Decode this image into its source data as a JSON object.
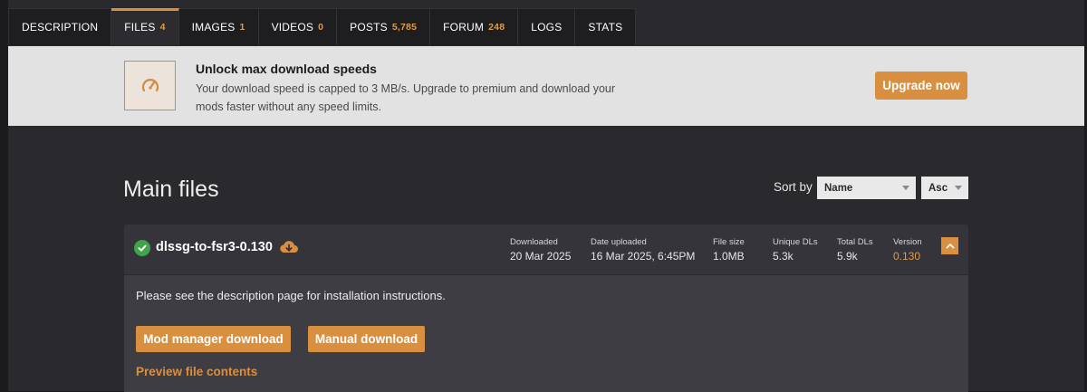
{
  "tabs": [
    {
      "label": "DESCRIPTION",
      "count": ""
    },
    {
      "label": "FILES",
      "count": "4"
    },
    {
      "label": "IMAGES",
      "count": "1"
    },
    {
      "label": "VIDEOS",
      "count": "0"
    },
    {
      "label": "POSTS",
      "count": "5,785"
    },
    {
      "label": "FORUM",
      "count": "248"
    },
    {
      "label": "LOGS",
      "count": ""
    },
    {
      "label": "STATS",
      "count": ""
    }
  ],
  "active_tab": "FILES",
  "banner": {
    "icon": "speedometer-icon",
    "title": "Unlock max download speeds",
    "text": "Your download speed is capped to 3 MB/s. Upgrade to premium and download your mods faster without any speed limits.",
    "button": "Upgrade now"
  },
  "main": {
    "title": "Main files",
    "sort_label": "Sort by",
    "sort_field": "Name",
    "sort_order": "Asc"
  },
  "file": {
    "name": "dlssg-to-fsr3-0.130",
    "status_icon": "check-circle-icon",
    "download_icon": "cloud-download-icon",
    "stats": {
      "downloaded_label": "Downloaded",
      "downloaded": "20 Mar 2025",
      "uploaded_label": "Date uploaded",
      "uploaded": "16 Mar 2025, 6:45PM",
      "size_label": "File size",
      "size": "1.0MB",
      "unique_label": "Unique DLs",
      "unique": "5.3k",
      "total_label": "Total DLs",
      "total": "5.9k",
      "version_label": "Version",
      "version": "0.130"
    },
    "description": "Please see the description page for installation instructions.",
    "mod_manager_button": "Mod manager download",
    "manual_button": "Manual download",
    "preview_link": "Preview file contents"
  },
  "colors": {
    "accent": "#d98f40",
    "success": "#3fa54a",
    "background": "#2a2a2e"
  }
}
